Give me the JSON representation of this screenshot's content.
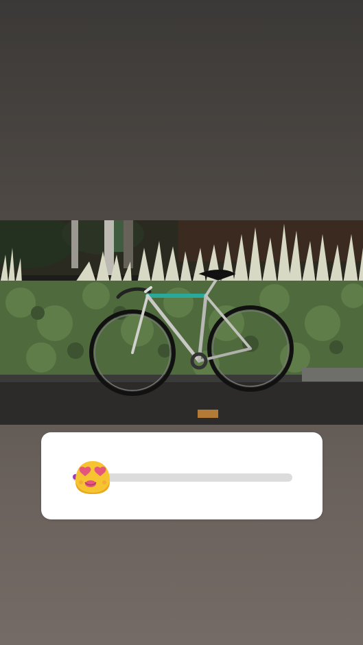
{
  "story": {
    "photo": {
      "subject": "bicycle-photo"
    },
    "slider": {
      "emoji": "😍",
      "emoji_icon": "heart-eyes-emoji-icon",
      "value": 0.0,
      "fill_color": "#a238c4",
      "track_color": "#dcdcdc",
      "card_color": "#ffffff"
    }
  }
}
